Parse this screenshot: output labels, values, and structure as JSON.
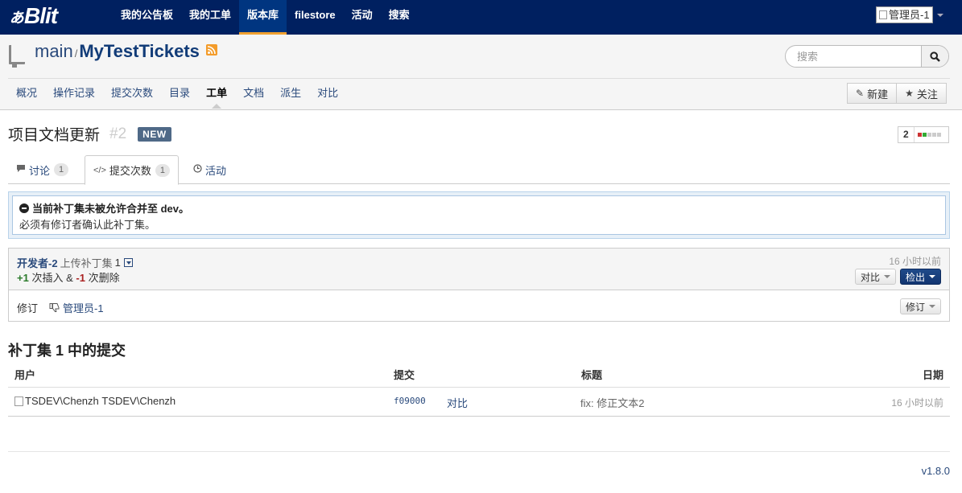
{
  "navbar": {
    "brand_badge": "ぁ",
    "brand_name": "Blit",
    "items": [
      {
        "label": "我的公告板"
      },
      {
        "label": "我的工单"
      },
      {
        "label": "版本库",
        "active": true
      },
      {
        "label": "filestore"
      },
      {
        "label": "活动"
      },
      {
        "label": "搜索"
      }
    ],
    "user": "管理员-1"
  },
  "repo": {
    "project": "main",
    "separator": "/",
    "name": "MyTestTickets",
    "icons": [
      "repository-icon",
      "rss-icon"
    ],
    "search_placeholder": "搜索",
    "tabs": [
      {
        "label": "概况"
      },
      {
        "label": "操作记录"
      },
      {
        "label": "提交次数"
      },
      {
        "label": "目录"
      },
      {
        "label": "工单",
        "active": true
      },
      {
        "label": "文档"
      },
      {
        "label": "派生"
      },
      {
        "label": "对比"
      }
    ],
    "new_label": "新建",
    "watch_label": "关注"
  },
  "ticket": {
    "title": "项目文档更新",
    "number": "#2",
    "status": "NEW",
    "votes": "2",
    "tabs": [
      {
        "label": "讨论",
        "count": "1",
        "icon": "comment-icon"
      },
      {
        "label": "提交次数",
        "count": "1",
        "icon": "code-icon",
        "active": true
      },
      {
        "label": "活动",
        "icon": "clock-icon"
      }
    ]
  },
  "alert": {
    "title": "当前补丁集未被允许合并至 dev。",
    "text": "必须有修订者确认此补丁集。",
    "icon": "minus-circle-icon"
  },
  "patchset": {
    "author": "开发者-2",
    "action": "上传补丁集",
    "number": "1",
    "insertions": "+1",
    "insertions_label": "次插入 &",
    "deletions": "-1",
    "deletions_label": "次删除",
    "time": "16 小时以前",
    "compare_label": "对比",
    "checkout_label": "检出",
    "review_label": "修订",
    "reviewer": "管理员-1",
    "review_button": "修订"
  },
  "commits": {
    "title": "补丁集 1 中的提交",
    "headers": {
      "user": "用户",
      "commit": "提交",
      "title": "标题",
      "date": "日期"
    },
    "rows": [
      {
        "avatar_alt": "TSDEV\\Chenzh",
        "user": "TSDEV\\Chenzh",
        "sha": "f09000",
        "diff": "对比",
        "title": "fix: 修正文本2",
        "date": "16 小时以前"
      }
    ]
  },
  "footer": {
    "version": "v1.8.0"
  },
  "colors": {
    "navbar": "#002060",
    "active_tab_underline": "#f0a030",
    "link": "#2a4a7c",
    "badge_new": "#4f6987"
  }
}
